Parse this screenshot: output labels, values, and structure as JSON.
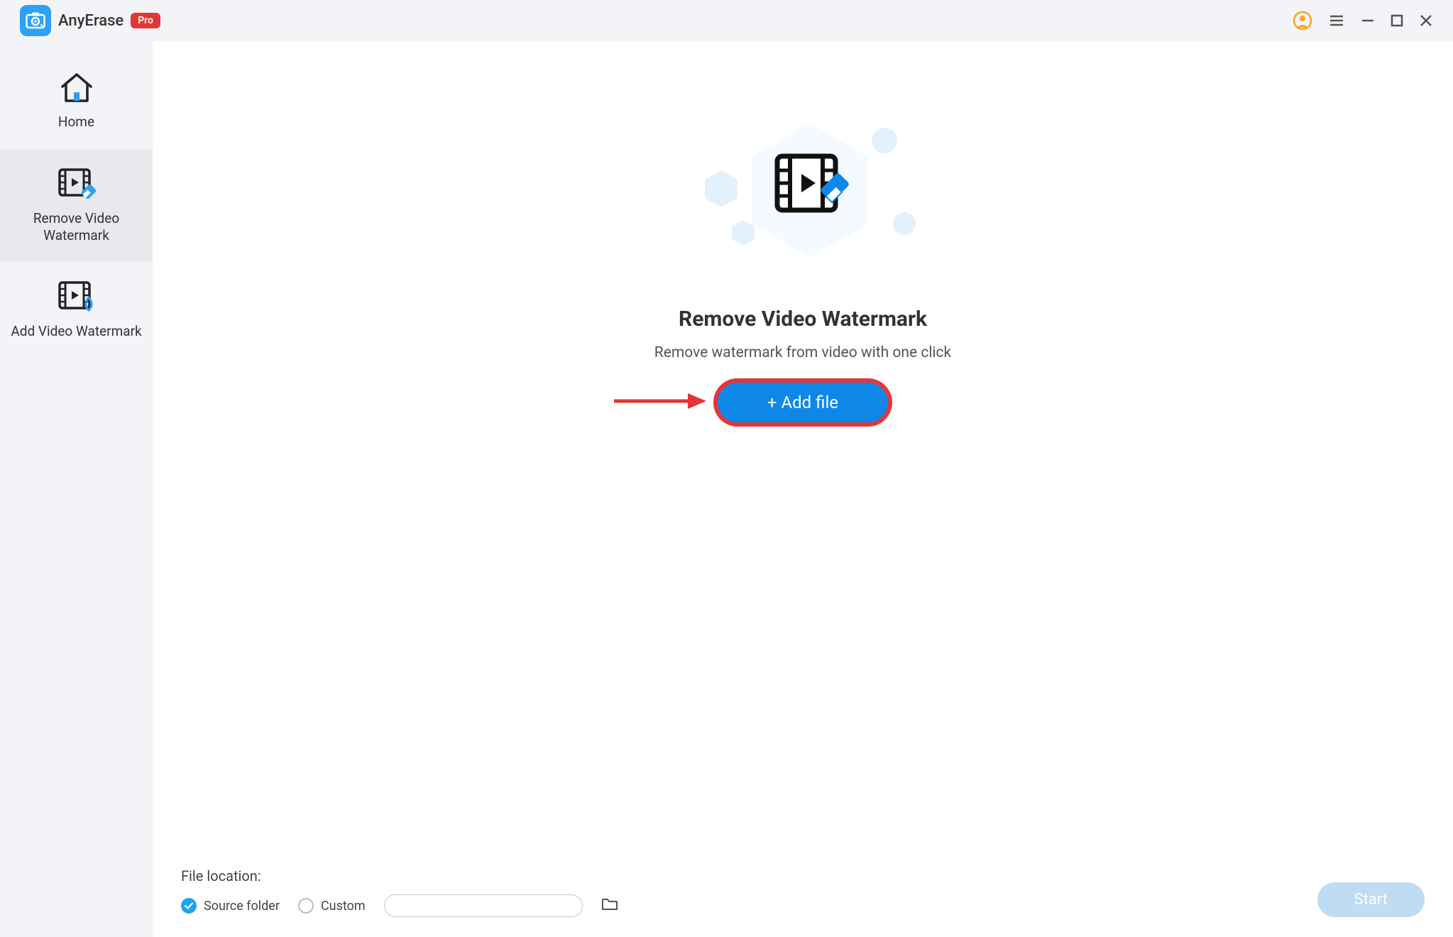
{
  "titlebar": {
    "app_name": "AnyErase",
    "badge": "Pro"
  },
  "sidebar": {
    "items": [
      {
        "label": "Home"
      },
      {
        "label": "Remove Video Watermark"
      },
      {
        "label": "Add Video Watermark"
      }
    ]
  },
  "hero": {
    "title": "Remove Video Watermark",
    "subtitle": "Remove watermark from video with one click",
    "add_file_label": "+ Add file"
  },
  "footer": {
    "location_label": "File location:",
    "option_source": "Source folder",
    "option_custom": "Custom",
    "custom_path": "",
    "start_label": "Start"
  },
  "colors": {
    "accent": "#0d88e8",
    "highlight": "#e33636",
    "light_blue": "#bedcf3"
  }
}
